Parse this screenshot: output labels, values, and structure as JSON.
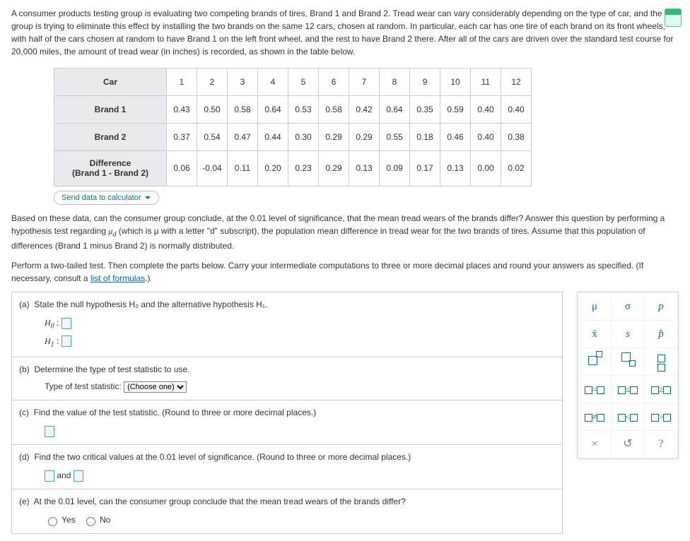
{
  "intro": "A consumer products testing group is evaluating two competing brands of tires, Brand 1 and Brand 2. Tread wear can vary considerably depending on the type of car, and the group is trying to eliminate this effect by installing the two brands on the same 12 cars, chosen at random. In particular, each car has one tire of each brand on its front wheels, with half of the cars chosen at random to have Brand 1 on the left front wheel, and the rest to have Brand 2 there. After all of the cars are driven over the standard test course for 20,000 miles, the amount of tread wear (in inches) is recorded, as shown in the table below.",
  "table": {
    "rowHeaders": [
      "Car",
      "Brand 1",
      "Brand 2",
      "Difference\n(Brand 1 - Brand 2)"
    ],
    "cols": [
      "1",
      "2",
      "3",
      "4",
      "5",
      "6",
      "7",
      "8",
      "9",
      "10",
      "11",
      "12"
    ],
    "rows": [
      [
        "0.43",
        "0.50",
        "0.58",
        "0.64",
        "0.53",
        "0.58",
        "0.42",
        "0.64",
        "0.35",
        "0.59",
        "0.40",
        "0.40"
      ],
      [
        "0.37",
        "0.54",
        "0.47",
        "0.44",
        "0.30",
        "0.29",
        "0.29",
        "0.55",
        "0.18",
        "0.46",
        "0.40",
        "0.38"
      ],
      [
        "0.06",
        "-0.04",
        "0.11",
        "0.20",
        "0.23",
        "0.29",
        "0.13",
        "0.09",
        "0.17",
        "0.13",
        "0.00",
        "0.02"
      ]
    ]
  },
  "sendBtn": "Send data to calculator",
  "q1_a": "Based on these data, can the consumer group conclude, at the ",
  "q1_sig": "0.01",
  "q1_b": " level of significance, that the mean tread wears of the brands differ? Answer this question by performing a hypothesis test regarding ",
  "q1_c": " (which is μ with a letter \"d\" subscript), the population mean difference in tread wear for the two brands of tires. Assume that this population of differences (Brand 1 minus Brand 2) is normally distributed.",
  "q2": "Perform a two-tailed test. Then complete the parts below. Carry your intermediate computations to three or more decimal places and round your answers as specified. (If necessary, consult a ",
  "q2_link": "list of formulas",
  "q2_end": ".)",
  "parts": {
    "a": "State the null hypothesis H₀ and the alternative hypothesis H₁.",
    "b": "Determine the type of test statistic to use.",
    "b_label": "Type of test statistic:",
    "b_choose": "(Choose one)",
    "c": "Find the value of the test statistic. (Round to three or more decimal places.)",
    "d": "Find the two critical values at the 0.01 level of significance. (Round to three or more decimal places.)",
    "d_and": "and",
    "e": "At the 0.01 level, can the consumer group conclude that the mean tread wears of the brands differ?",
    "yes": "Yes",
    "no": "No"
  },
  "toolbox": {
    "r1": [
      "μ",
      "σ",
      "p"
    ],
    "r2": [
      "x̄",
      "s",
      "p̂"
    ],
    "r4": [
      "□=□",
      "□≤□",
      "□≥□"
    ],
    "r5": [
      "□≠□",
      "□<□",
      "□>□"
    ],
    "r6": [
      "×",
      "↺",
      "?"
    ]
  },
  "chart_data": {
    "type": "table",
    "title": "Paired tread-wear (inches) for 12 cars",
    "columns": [
      "Car",
      "Brand 1",
      "Brand 2",
      "Difference (Brand1 - Brand2)"
    ],
    "rows": [
      [
        1,
        0.43,
        0.37,
        0.06
      ],
      [
        2,
        0.5,
        0.54,
        -0.04
      ],
      [
        3,
        0.58,
        0.47,
        0.11
      ],
      [
        4,
        0.64,
        0.44,
        0.2
      ],
      [
        5,
        0.53,
        0.3,
        0.23
      ],
      [
        6,
        0.58,
        0.29,
        0.29
      ],
      [
        7,
        0.42,
        0.29,
        0.13
      ],
      [
        8,
        0.64,
        0.55,
        0.09
      ],
      [
        9,
        0.35,
        0.18,
        0.17
      ],
      [
        10,
        0.59,
        0.46,
        0.13
      ],
      [
        11,
        0.4,
        0.4,
        0.0
      ],
      [
        12,
        0.4,
        0.38,
        0.02
      ]
    ]
  }
}
